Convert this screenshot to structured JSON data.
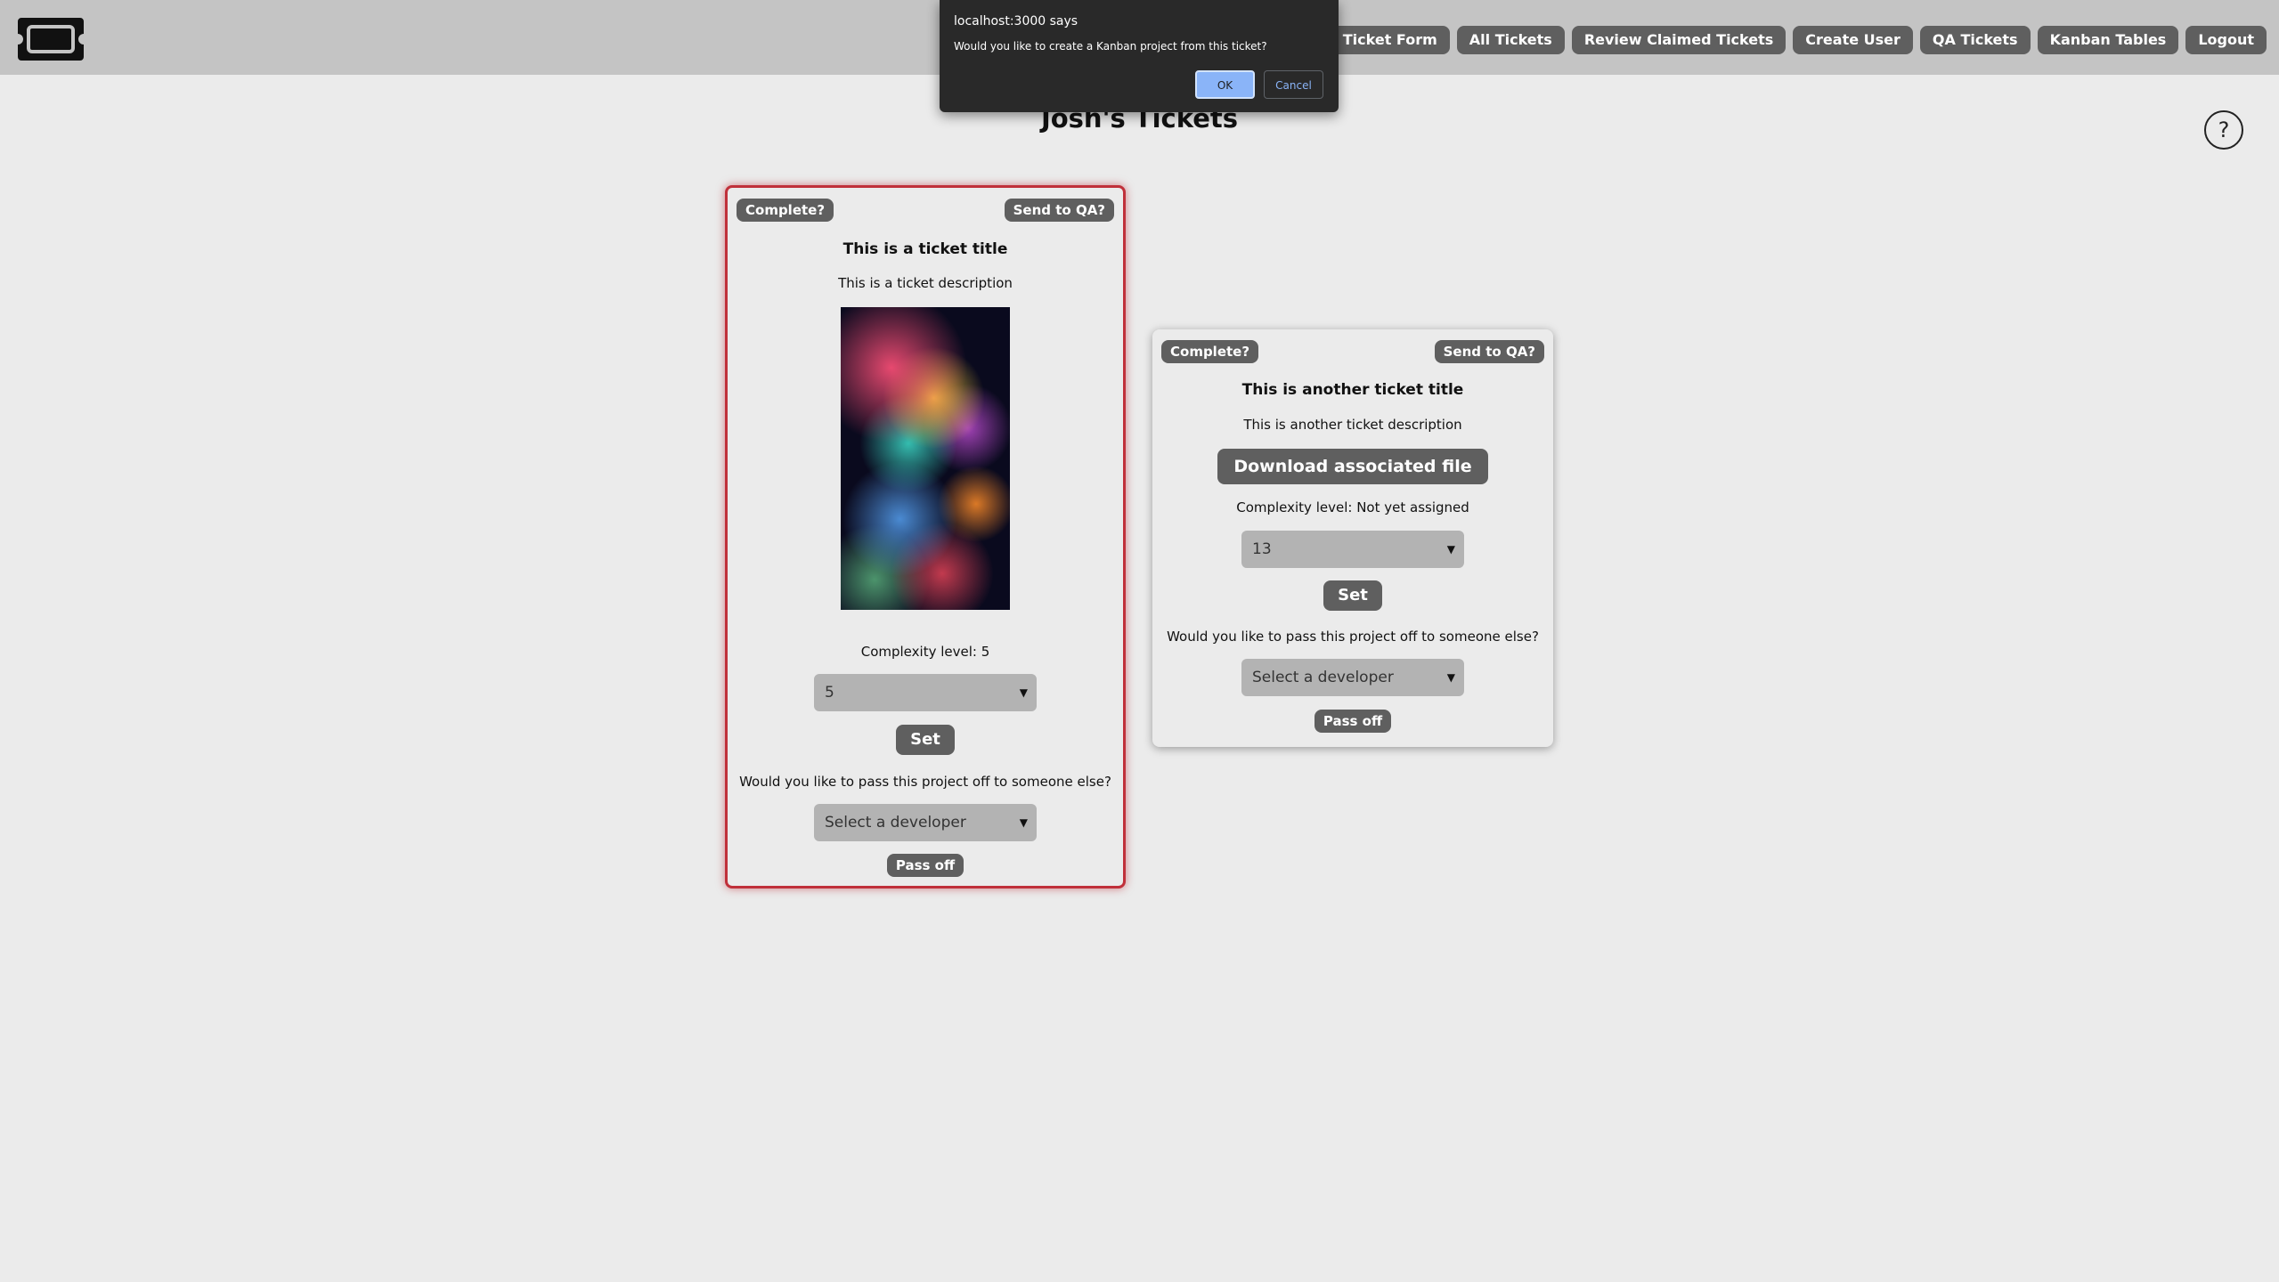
{
  "header": {
    "logo_icon": "ticket-icon",
    "nav": [
      {
        "label": "Ticket Form"
      },
      {
        "label": "All Tickets"
      },
      {
        "label": "Review Claimed Tickets"
      },
      {
        "label": "Create User"
      },
      {
        "label": "QA Tickets"
      },
      {
        "label": "Kanban Tables"
      },
      {
        "label": "Logout"
      }
    ]
  },
  "page": {
    "title": "Josh's Tickets",
    "help_label": "?"
  },
  "tickets": [
    {
      "complete_label": "Complete?",
      "qa_label": "Send to QA?",
      "title": "This is a ticket title",
      "description": "This is a ticket description",
      "attachment": "image",
      "complexity_text": "Complexity level: 5",
      "complexity_selected": "5",
      "set_label": "Set",
      "pass_question": "Would you like to pass this project off to someone else?",
      "developer_selected": "Select a developer",
      "pass_label": "Pass off",
      "highlighted": true
    },
    {
      "complete_label": "Complete?",
      "qa_label": "Send to QA?",
      "title": "This is another ticket title",
      "description": "This is another ticket description",
      "download_label": "Download associated file",
      "complexity_text": "Complexity level: Not yet assigned",
      "complexity_selected": "13",
      "set_label": "Set",
      "pass_question": "Would you like to pass this project off to someone else?",
      "developer_selected": "Select a developer",
      "pass_label": "Pass off",
      "highlighted": false
    }
  ],
  "dialog": {
    "origin": "localhost:3000 says",
    "message": "Would you like to create a Kanban project from this ticket?",
    "ok_label": "OK",
    "cancel_label": "Cancel"
  },
  "colors": {
    "topbar": "#c4c4c4",
    "background": "#ebebeb",
    "button": "#5f5f5f",
    "highlight_border": "#c0303a",
    "dialog_bg": "#292929",
    "dialog_accent": "#8ab4f8"
  }
}
